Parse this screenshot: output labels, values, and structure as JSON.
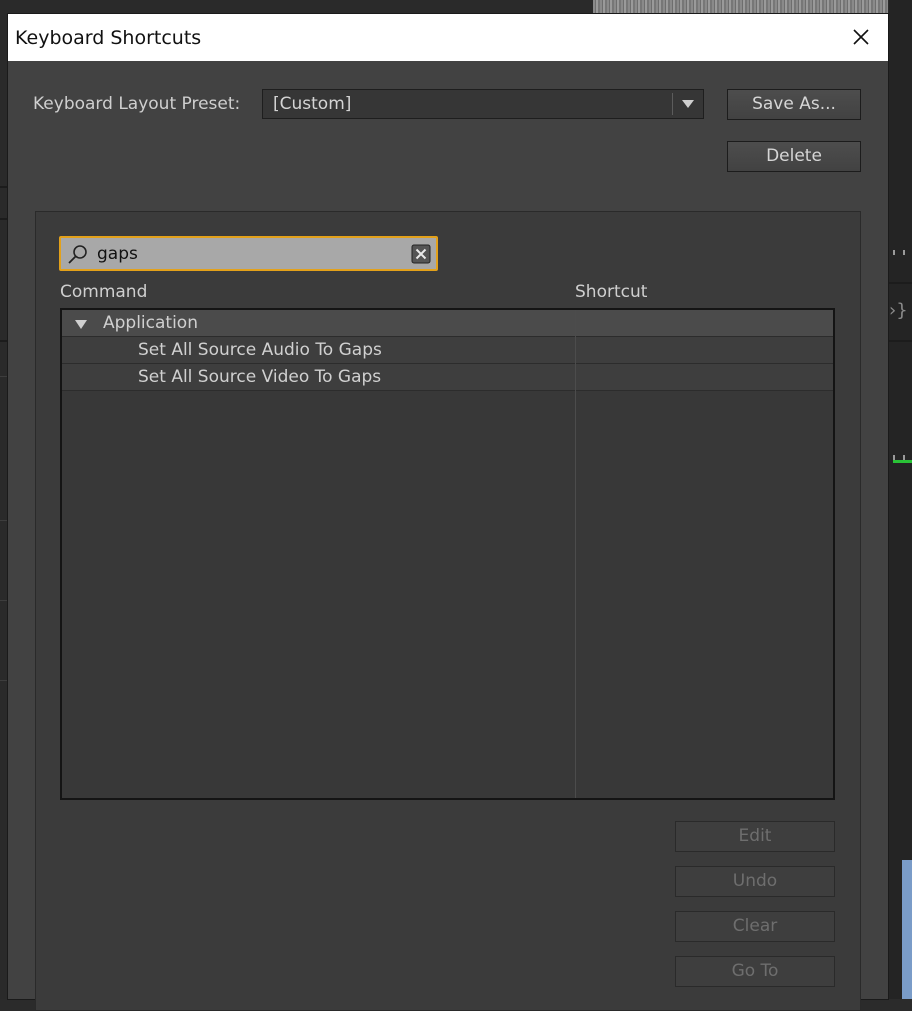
{
  "dialog": {
    "title": "Keyboard Shortcuts",
    "close_icon": "close-icon"
  },
  "preset": {
    "label": "Keyboard Layout Preset:",
    "value": "[Custom]",
    "save_as_label": "Save As...",
    "delete_label": "Delete"
  },
  "search": {
    "value": "gaps",
    "icon": "search-icon",
    "clear_icon": "clear-icon"
  },
  "table": {
    "columns": {
      "command": "Command",
      "shortcut": "Shortcut"
    },
    "group": {
      "label": "Application",
      "expanded": true
    },
    "rows": [
      {
        "command": "Set All Source Audio To Gaps",
        "shortcut": ""
      },
      {
        "command": "Set All Source Video To Gaps",
        "shortcut": ""
      }
    ]
  },
  "actions": {
    "edit": "Edit",
    "undo": "Undo",
    "clear": "Clear",
    "goto": "Go To"
  },
  "colors": {
    "search_focus": "#e3a11a",
    "dialog_bg": "#424242",
    "disabled_text": "#6e6e6e"
  }
}
